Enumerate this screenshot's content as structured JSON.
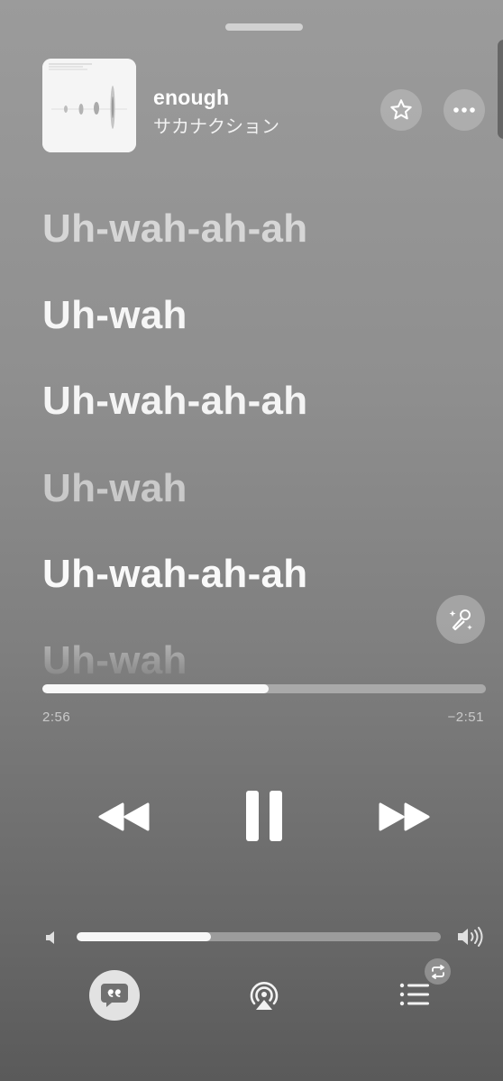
{
  "now_playing": {
    "title": "enough",
    "artist": "サカナクション",
    "artwork": "album-artwork-waveform"
  },
  "header_actions": {
    "favorite_icon": "star-icon",
    "more_icon": "ellipsis-icon"
  },
  "lyrics": [
    "Uh-wah-ah-ah",
    "Uh-wah",
    "Uh-wah-ah-ah",
    "Uh-wah",
    "Uh-wah-ah-ah",
    "Uh-wah"
  ],
  "sing_button_icon": "microphone-sparkle-icon",
  "playback": {
    "elapsed": "2:56",
    "remaining": "−2:51",
    "progress_fraction": 0.51
  },
  "transport": {
    "rewind_icon": "backward-icon",
    "pause_icon": "pause-icon",
    "forward_icon": "forward-icon"
  },
  "volume": {
    "level_fraction": 0.37,
    "low_icon": "speaker-low-icon",
    "high_icon": "speaker-high-icon"
  },
  "bottom_bar": {
    "lyrics_icon": "quote-bubble-icon",
    "airplay_icon": "airplay-audio-icon",
    "queue_icon": "list-icon",
    "repeat_badge_icon": "repeat-icon"
  },
  "colors": {
    "background_top": "#9b9b9b",
    "background_bottom": "#5a5a5a",
    "accent": "#ffffff"
  }
}
